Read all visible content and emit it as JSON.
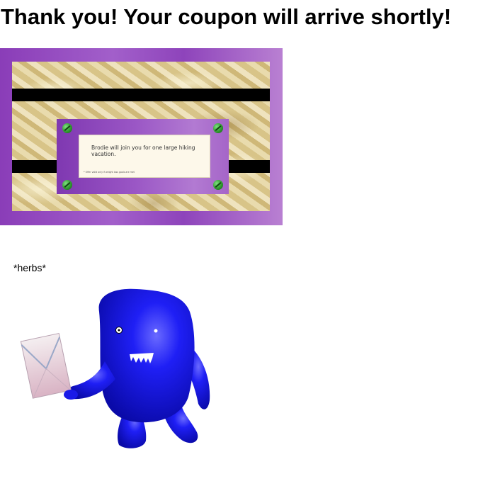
{
  "page": {
    "headline": "Thank you! Your coupon will arrive shortly!",
    "caption": "*herbs*"
  },
  "coupon": {
    "message": "Brodie will join you for one large hiking vacation.",
    "fine_print": "* Offer valid only if weight loss goals are met",
    "colors": {
      "frame_purple": "#8e44bb",
      "marble": "#d8c488",
      "band": "#000000",
      "screw_green": "#2f9a2f",
      "card": "#fdf8ea"
    }
  },
  "illustration": {
    "subject": "blue monster holding envelope",
    "colors": {
      "monster_blue": "#1a1aff",
      "envelope": "#e4c4d2"
    }
  }
}
